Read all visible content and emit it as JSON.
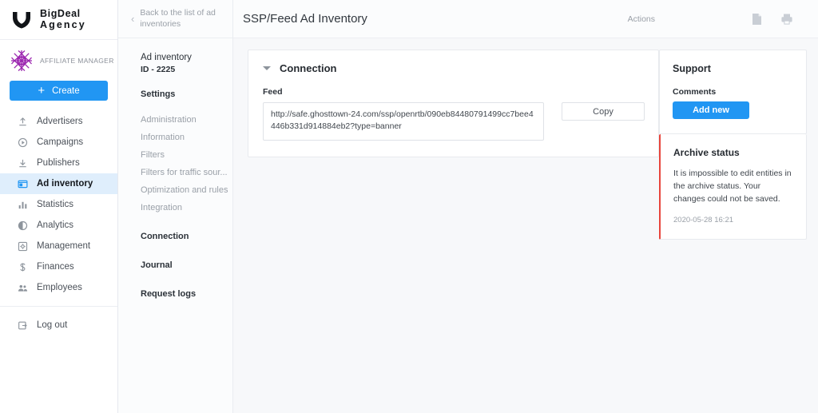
{
  "brand": {
    "line1": "BigDeal",
    "line2": "Agency",
    "logo_icon": "shield-bull-logo-icon"
  },
  "account": {
    "name": "AFFILIATE MANAGER",
    "avatar_icon": "snowflake-avatar-icon",
    "avatar_color": "#9c27b0"
  },
  "create": {
    "label": "Create",
    "plus_icon": "plus-icon",
    "color": "#2196f3"
  },
  "sidebar": {
    "items": [
      {
        "label": "Advertisers",
        "icon": "upload-arrow-icon"
      },
      {
        "label": "Campaigns",
        "icon": "play-circle-icon"
      },
      {
        "label": "Publishers",
        "icon": "download-arrow-icon"
      },
      {
        "label": "Ad inventory",
        "icon": "window-panel-icon",
        "active": true
      },
      {
        "label": "Statistics",
        "icon": "bar-chart-icon"
      },
      {
        "label": "Analytics",
        "icon": "pie-chart-icon"
      },
      {
        "label": "Management",
        "icon": "settings-square-icon"
      },
      {
        "label": "Finances",
        "icon": "dollar-sign-icon"
      },
      {
        "label": "Employees",
        "icon": "people-icon"
      }
    ],
    "logout": {
      "label": "Log out",
      "icon": "logout-arrow-icon"
    },
    "active_bg": "#dfeefc"
  },
  "subnav": {
    "back": {
      "label": "Back to the list of ad inventories",
      "icon": "chevron-left-icon"
    },
    "entity_title": "Ad inventory",
    "entity_id": "ID - 2225",
    "settings_label": "Settings",
    "settings_children": [
      "Administration",
      "Information",
      "Filters",
      "Filters for traffic sour...",
      "Optimization and rules",
      "Integration"
    ],
    "groups": [
      "Connection",
      "Journal",
      "Request logs"
    ]
  },
  "topbar": {
    "title": "SSP/Feed Ad Inventory",
    "actions_label": "Actions",
    "icons": [
      {
        "name": "document-icon"
      },
      {
        "name": "printer-icon"
      }
    ]
  },
  "connection": {
    "section_title": "Connection",
    "collapse_icon": "triangle-down-icon",
    "feed_label": "Feed",
    "feed_value": "http://safe.ghosttown-24.com/ssp/openrtb/090eb84480791499cc7bee4446b331d914884eb2?type=banner",
    "copy_label": "Copy"
  },
  "support": {
    "title": "Support",
    "comments_label": "Comments",
    "add_new_label": "Add new"
  },
  "archive": {
    "title": "Archive status",
    "message": "It is impossible to edit entities in the archive status. Your changes could not be saved.",
    "date": "2020-05-28 16:21",
    "accent_color": "#e8453c"
  }
}
